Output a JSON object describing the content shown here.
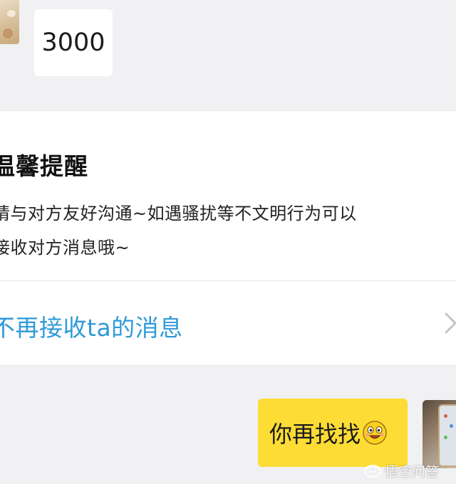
{
  "messages": {
    "incoming": {
      "text": "3000",
      "avatar_icon": "cat-avatar-photo"
    },
    "outgoing": {
      "text": "你再找找",
      "emoji_icon": "grinning-face-emoji",
      "avatar_icon": "phone-photo-avatar"
    }
  },
  "reminder_card": {
    "title": "温馨提醒",
    "body_line1": "请与对方友好沟通~如遇骚扰等不文明行为可以",
    "body_line2": "接收对方消息哦~",
    "block_action_label": "不再接收ta的消息",
    "chevron_icon": "chevron-right-icon"
  },
  "watermark": {
    "text": "悟空问答",
    "icon": "wukong-logo-icon"
  },
  "colors": {
    "background": "#f1f1f3",
    "outgoing_bubble": "#fddc35",
    "link_blue": "#2f9ad8"
  }
}
